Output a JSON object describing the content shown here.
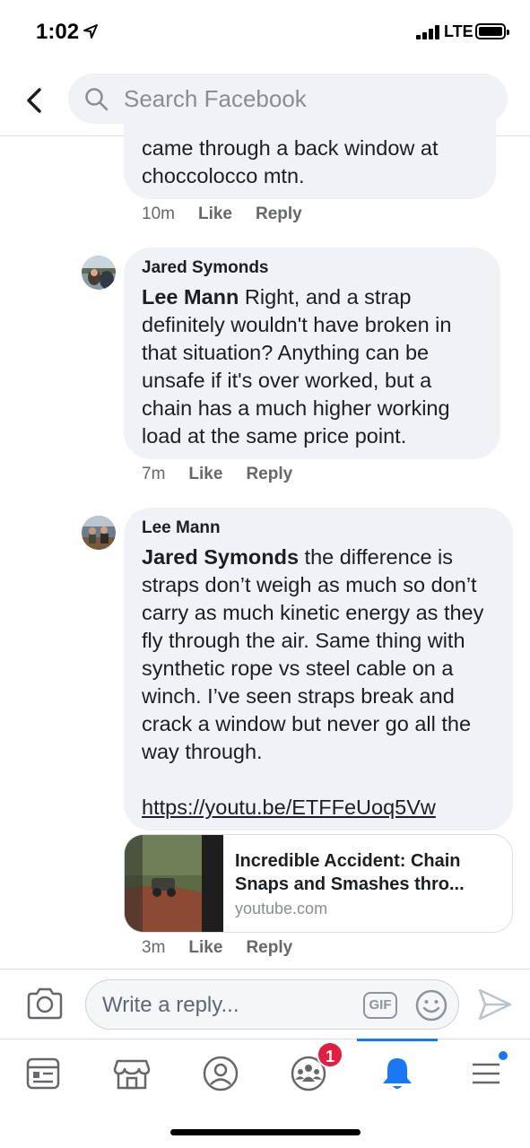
{
  "status_bar": {
    "time": "1:02",
    "network": "LTE"
  },
  "search": {
    "placeholder": "Search Facebook"
  },
  "comments": [
    {
      "text": "came through a back window at choccolocco mtn.",
      "time": "10m",
      "like_label": "Like",
      "reply_label": "Reply"
    },
    {
      "author": "Jared Symonds",
      "mention": "Lee Mann",
      "text": " Right, and a strap definitely wouldn't have broken in that situation? Anything can be unsafe if it's over worked, but a chain has a much higher working load at the same price point.",
      "time": "7m",
      "like_label": "Like",
      "reply_label": "Reply"
    },
    {
      "author": "Lee Mann",
      "mention": "Jared Symonds",
      "text": " the difference is straps don’t weigh as much so don’t carry as much kinetic energy as they fly through the air. Same thing with synthetic rope vs steel cable on a winch. I’ve seen straps break and crack a window but never go all the way through.",
      "link": "https://youtu.be/ETFFeUoq5Vw",
      "time": "3m",
      "like_label": "Like",
      "reply_label": "Reply"
    }
  ],
  "link_preview": {
    "title_line1": "Incredible Accident: Chain",
    "title_line2": "Snaps and Smashes thro...",
    "domain": "youtube.com"
  },
  "composer": {
    "placeholder": "Write a reply...",
    "gif_label": "GIF"
  },
  "bottom_nav": {
    "items": [
      "news-feed-icon",
      "marketplace-icon",
      "profile-icon",
      "groups-icon",
      "notifications-icon",
      "menu-icon"
    ],
    "groups_badge": "1",
    "active": "notifications-icon"
  },
  "colors": {
    "accent": "#1877f2",
    "badge": "#e41e3f",
    "bubble": "#f0f2f5",
    "secondary_text": "#65676b"
  }
}
